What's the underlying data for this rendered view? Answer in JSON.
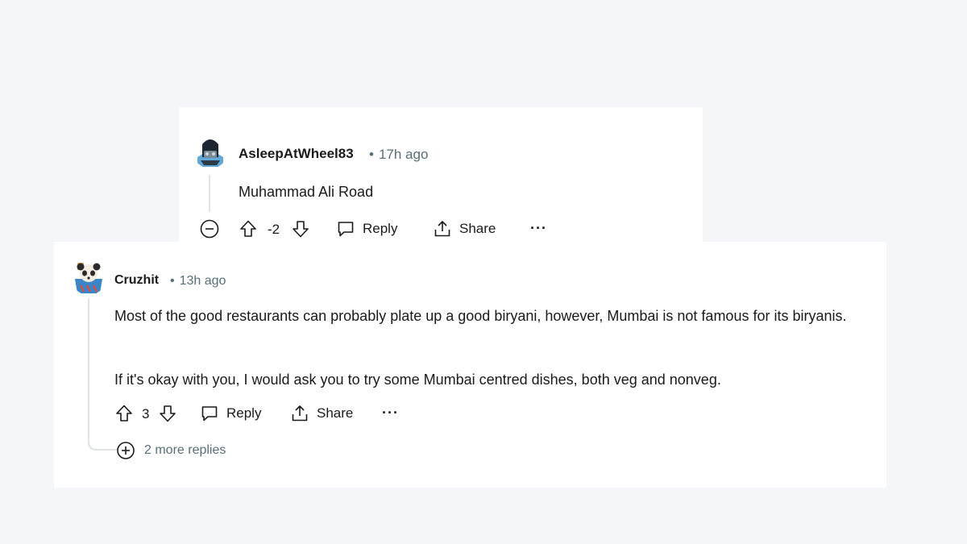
{
  "comment1": {
    "username": "AsleepAtWheel83",
    "dot": "•",
    "time": "17h ago",
    "body": "Muhammad Ali Road",
    "score": "-2",
    "reply_label": "Reply",
    "share_label": "Share",
    "more_label": "···"
  },
  "comment2": {
    "username": "Cruzhit",
    "dot": "•",
    "time": "13h ago",
    "paragraphs": [
      "Most of the good restaurants can probably plate up a good biryani, however, Mumbai is not famous for its biryanis.",
      "If it's okay with you, I would ask you to try some Mumbai centred dishes, both veg and nonveg."
    ],
    "score": "3",
    "reply_label": "Reply",
    "share_label": "Share",
    "more_label": "···",
    "more_replies": "2 more replies"
  },
  "colors": {
    "text": "#1a1a1b",
    "meta": "#576f76",
    "thread_line": "#dfe3e6",
    "card": "#ffffff",
    "background": "#f5f6f7"
  },
  "icons": [
    "collapse-minus-icon",
    "upvote-arrow-icon",
    "downvote-arrow-icon",
    "comment-bubble-icon",
    "share-upload-icon",
    "more-dots-icon",
    "expand-plus-icon"
  ]
}
